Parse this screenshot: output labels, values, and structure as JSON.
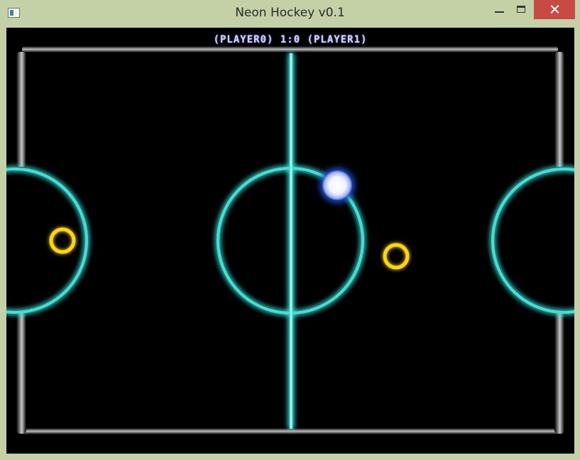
{
  "window": {
    "title": "Neon Hockey v0.1"
  },
  "scoreboard": {
    "text": "(PLAYER0) 1:0 (PLAYER1)"
  },
  "colors": {
    "rink_lines": "#3fe0d6",
    "mallets": "#ffd800",
    "puck": "#ffffff",
    "puck_glow": "#1e4fd1",
    "background": "#000000",
    "score_text": "#cfd0ff",
    "close_button": "#c74a45"
  },
  "icons": {
    "minimize": "minimize-icon",
    "maximize": "maximize-icon",
    "close": "close-icon"
  }
}
